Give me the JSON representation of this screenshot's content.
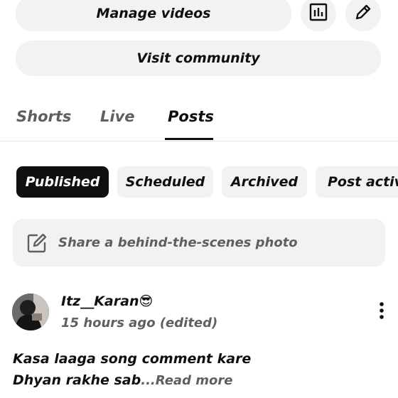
{
  "actions": {
    "manage_videos": "Manage videos",
    "visit_community": "Visit community"
  },
  "tabs": [
    {
      "label": "Shorts",
      "active": false
    },
    {
      "label": "Live",
      "active": false
    },
    {
      "label": "Posts",
      "active": true
    }
  ],
  "filters": [
    {
      "label": "Published",
      "active": true
    },
    {
      "label": "Scheduled",
      "active": false
    },
    {
      "label": "Archived",
      "active": false
    },
    {
      "label": "Post activi",
      "active": false
    }
  ],
  "share": {
    "placeholder": "Share a behind-the-scenes photo",
    "icon": "edit-square-icon"
  },
  "post": {
    "author": "Itz__Karan😎",
    "time": "15 hours ago (edited)",
    "line1": "Kasa laaga song comment kare",
    "line2": "Dhyan rakhe sab",
    "read_more": "...Read more"
  },
  "colors": {
    "chip_bg": "#f2f2f2",
    "chip_active_bg": "#0f0f0f",
    "text": "#0f0f0f",
    "muted": "#5f5f5f"
  }
}
